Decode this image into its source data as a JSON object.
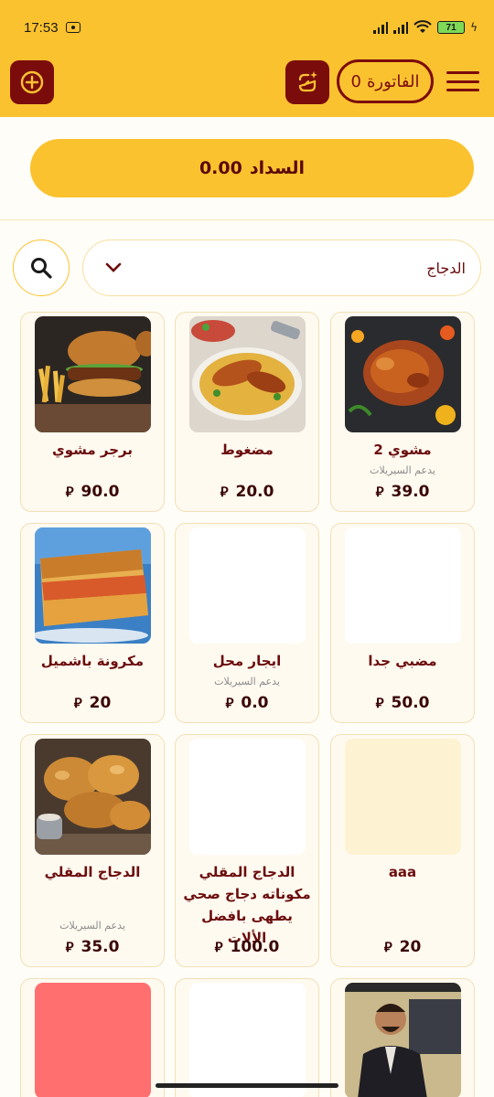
{
  "status_bar": {
    "time": "17:53",
    "battery": "71"
  },
  "header": {
    "invoice_label": "الفاتورة",
    "invoice_count": "0",
    "icons": {
      "add": "plus-circle-icon",
      "special": "sparkle-chip-icon",
      "menu": "hamburger-menu-icon"
    }
  },
  "payment": {
    "label": "السداد",
    "amount": "0.00"
  },
  "filter": {
    "category": "الدجاج",
    "search_icon": "search-icon",
    "dropdown_icon": "chevron-down-icon"
  },
  "currency_symbol": "⃁",
  "products": [
    {
      "name": "مشوي 2",
      "note": "يدعم السيريلات",
      "price": "39.0",
      "image": "grilled-chicken"
    },
    {
      "name": "مضغوط",
      "note": "",
      "price": "20.0",
      "image": "chicken-rice"
    },
    {
      "name": "برجر مشوي",
      "note": "",
      "price": "90.0",
      "image": "burger-fries"
    },
    {
      "name": "مضبي جدا",
      "note": "",
      "price": "50.0",
      "image": "blank"
    },
    {
      "name": "ايجار محل",
      "note": "يدعم السيريلات",
      "price": "0.0",
      "image": "blank"
    },
    {
      "name": "مكرونة باشميل",
      "note": "",
      "price": "20",
      "image": "bechamel-pasta"
    },
    {
      "name": "aaa",
      "note": "",
      "price": "20",
      "image": "cream"
    },
    {
      "name": "الدجاج المقلي مكوناته دجاج صحي يطهى بافضل الألات",
      "note": "",
      "price": "100.0",
      "image": "blank"
    },
    {
      "name": "الدجاج المقلي",
      "note": "يدعم السيريلات",
      "price": "35.0",
      "image": "fried-chicken"
    },
    {
      "name": "",
      "note": "",
      "price": "",
      "image": "man-portrait"
    },
    {
      "name": "",
      "note": "",
      "price": "",
      "image": "blank"
    },
    {
      "name": "",
      "note": "",
      "price": "",
      "image": "salmon"
    }
  ]
}
